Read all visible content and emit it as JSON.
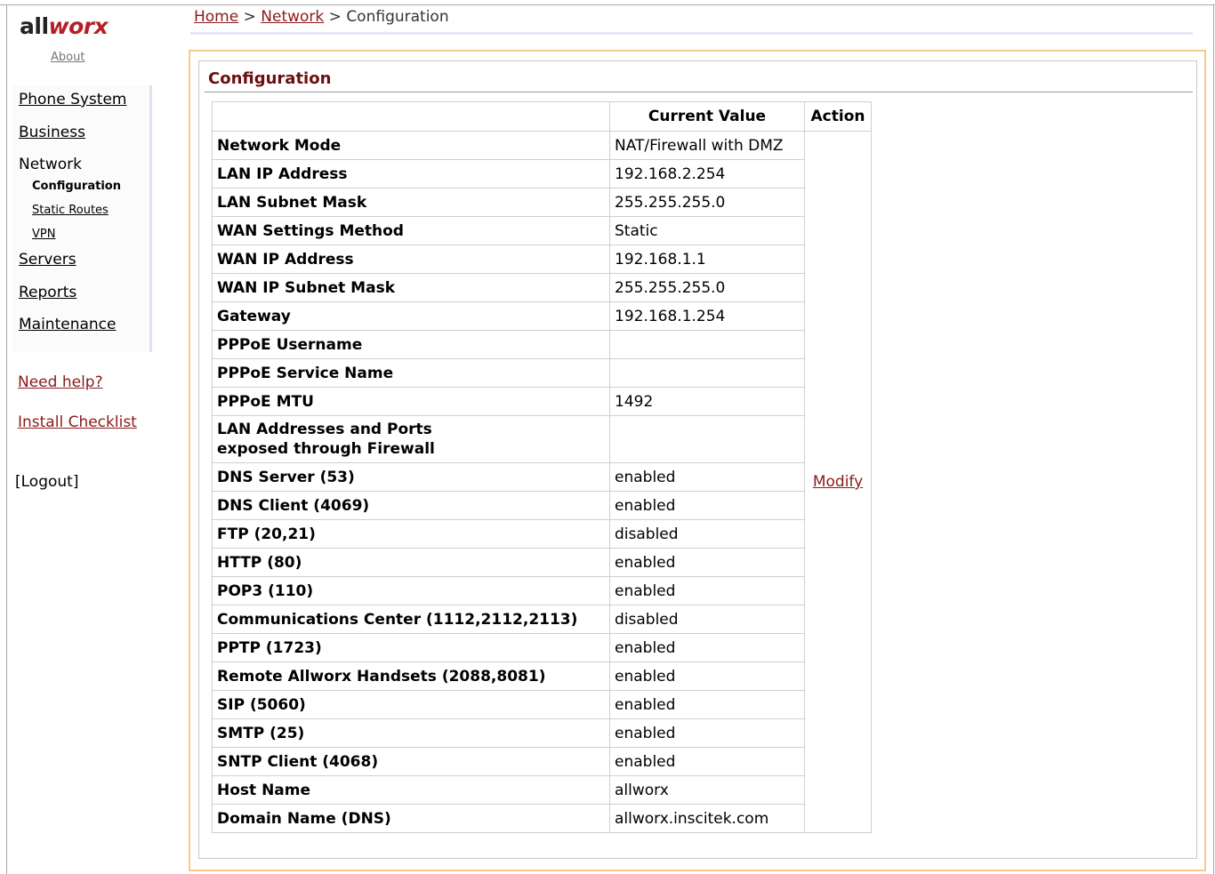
{
  "brand": {
    "logo_text_1": "all",
    "logo_text_2": "worx",
    "about": "About"
  },
  "nav": {
    "phone_system": "Phone System",
    "business": "Business",
    "network": "Network",
    "configuration": "Configuration",
    "static_routes": "Static Routes",
    "vpn": "VPN",
    "servers": "Servers",
    "reports": "Reports",
    "maintenance": "Maintenance"
  },
  "help": {
    "need_help": "Need help?",
    "install_checklist": "Install Checklist"
  },
  "logout": "[Logout]",
  "breadcrumb": {
    "home": "Home",
    "sep": ">",
    "network": "Network",
    "current": "Configuration"
  },
  "panel": {
    "title": "Configuration"
  },
  "table": {
    "headers": {
      "name": "",
      "value": "Current Value",
      "action": "Action"
    },
    "action_label": "Modify",
    "rows": [
      {
        "label": "Network Mode",
        "value": "NAT/Firewall with DMZ"
      },
      {
        "label": "LAN IP Address",
        "value": "192.168.2.254"
      },
      {
        "label": "LAN Subnet Mask",
        "value": "255.255.255.0"
      },
      {
        "label": "WAN Settings Method",
        "value": "Static"
      },
      {
        "label": "WAN IP Address",
        "value": "192.168.1.1"
      },
      {
        "label": "WAN IP Subnet Mask",
        "value": "255.255.255.0"
      },
      {
        "label": "Gateway",
        "value": "192.168.1.254"
      },
      {
        "label": "PPPoE Username",
        "value": ""
      },
      {
        "label": "PPPoE Service Name",
        "value": ""
      },
      {
        "label": "PPPoE MTU",
        "value": "1492"
      },
      {
        "label": "LAN Addresses and Ports\nexposed through Firewall",
        "value": ""
      },
      {
        "label": "DNS Server (53)",
        "value": "enabled"
      },
      {
        "label": "DNS Client (4069)",
        "value": "enabled"
      },
      {
        "label": "FTP (20,21)",
        "value": "disabled"
      },
      {
        "label": "HTTP (80)",
        "value": "enabled"
      },
      {
        "label": "POP3 (110)",
        "value": "enabled"
      },
      {
        "label": "Communications Center (1112,2112,2113)",
        "value": "disabled"
      },
      {
        "label": "PPTP (1723)",
        "value": "enabled"
      },
      {
        "label": "Remote Allworx Handsets (2088,8081)",
        "value": "enabled"
      },
      {
        "label": "SIP (5060)",
        "value": "enabled"
      },
      {
        "label": "SMTP (25)",
        "value": "enabled"
      },
      {
        "label": "SNTP Client (4068)",
        "value": "enabled"
      },
      {
        "label": "Host Name",
        "value": "allworx"
      },
      {
        "label": "Domain Name (DNS)",
        "value": "allworx.inscitek.com"
      }
    ]
  }
}
